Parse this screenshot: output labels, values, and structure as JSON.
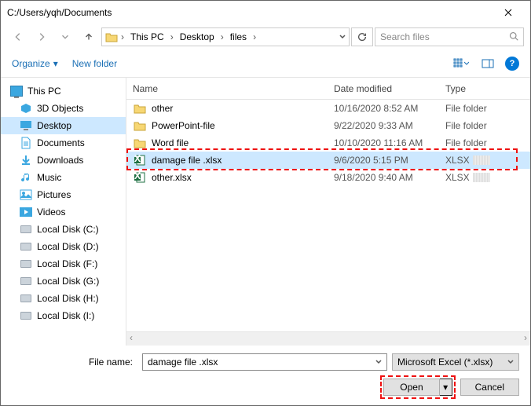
{
  "titlebar": {
    "path": "C:/Users/yqh/Documents"
  },
  "breadcrumb": {
    "root_dd": "",
    "seg1": "This PC",
    "seg2": "Desktop",
    "seg3": "files"
  },
  "search": {
    "placeholder": "Search files"
  },
  "toolbar": {
    "organize": "Organize",
    "new_folder": "New folder"
  },
  "columns": {
    "name": "Name",
    "date": "Date modified",
    "type": "Type"
  },
  "sidebar": {
    "root": "This PC",
    "items": [
      {
        "label": "3D Objects",
        "kind": "3d"
      },
      {
        "label": "Desktop",
        "kind": "desktop",
        "selected": true
      },
      {
        "label": "Documents",
        "kind": "docs"
      },
      {
        "label": "Downloads",
        "kind": "dl"
      },
      {
        "label": "Music",
        "kind": "music"
      },
      {
        "label": "Pictures",
        "kind": "pics"
      },
      {
        "label": "Videos",
        "kind": "vids"
      },
      {
        "label": "Local Disk (C:)",
        "kind": "disk"
      },
      {
        "label": "Local Disk (D:)",
        "kind": "disk"
      },
      {
        "label": "Local Disk (F:)",
        "kind": "disk"
      },
      {
        "label": "Local Disk (G:)",
        "kind": "disk"
      },
      {
        "label": "Local Disk (H:)",
        "kind": "disk"
      },
      {
        "label": "Local Disk (I:)",
        "kind": "disk"
      }
    ]
  },
  "files": [
    {
      "name": "other",
      "date": "10/16/2020 8:52 AM",
      "type": "File folder",
      "kind": "folder"
    },
    {
      "name": "PowerPoint-file",
      "date": "9/22/2020 9:33 AM",
      "type": "File folder",
      "kind": "folder"
    },
    {
      "name": "Word file",
      "date": "10/10/2020 11:16 AM",
      "type": "File folder",
      "kind": "folder"
    },
    {
      "name": "damage file .xlsx",
      "date": "9/6/2020 5:15 PM",
      "type": "XLSX",
      "kind": "xlsx",
      "selected": true
    },
    {
      "name": "other.xlsx",
      "date": "9/18/2020 9:40 AM",
      "type": "XLSX",
      "kind": "xlsx"
    }
  ],
  "footer": {
    "filename_label": "File name:",
    "filename_value": "damage file .xlsx",
    "filter": "Microsoft Excel (*.xlsx)",
    "open": "Open",
    "cancel": "Cancel"
  }
}
